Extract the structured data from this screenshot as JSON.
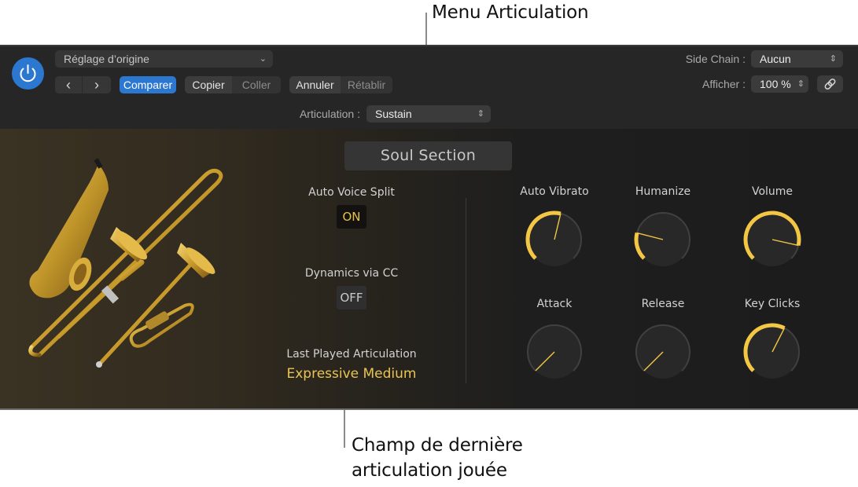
{
  "callouts": {
    "top": "Menu Articulation",
    "bottom_line1": "Champ de dernière",
    "bottom_line2": "articulation jouée"
  },
  "header": {
    "preset": "Réglage d’origine",
    "prev_icon": "‹",
    "next_icon": "›",
    "compare": "Comparer",
    "copy": "Copier",
    "paste": "Coller",
    "undo": "Annuler",
    "redo": "Rétablir",
    "articulation_label": "Articulation :",
    "articulation_value": "Sustain",
    "sidechain_label": "Side Chain :",
    "sidechain_value": "Aucun",
    "view_label": "Afficher :",
    "view_value": "100 %",
    "accent_color": "#2c77d0"
  },
  "instrument": {
    "title": "Soul Section",
    "auto_voice_split": {
      "label": "Auto Voice Split",
      "state": "ON"
    },
    "dynamics_cc": {
      "label": "Dynamics via CC",
      "state": "OFF"
    },
    "last_played": {
      "label": "Last Played Articulation",
      "value": "Expressive Medium"
    },
    "knob_color": "#f3c644",
    "knobs": [
      {
        "label": "Auto Vibrato",
        "value": 0.55
      },
      {
        "label": "Humanize",
        "value": 0.22
      },
      {
        "label": "Volume",
        "value": 0.88
      },
      {
        "label": "Attack",
        "value": 0.0
      },
      {
        "label": "Release",
        "value": 0.0
      },
      {
        "label": "Key Clicks",
        "value": 0.6
      }
    ]
  }
}
